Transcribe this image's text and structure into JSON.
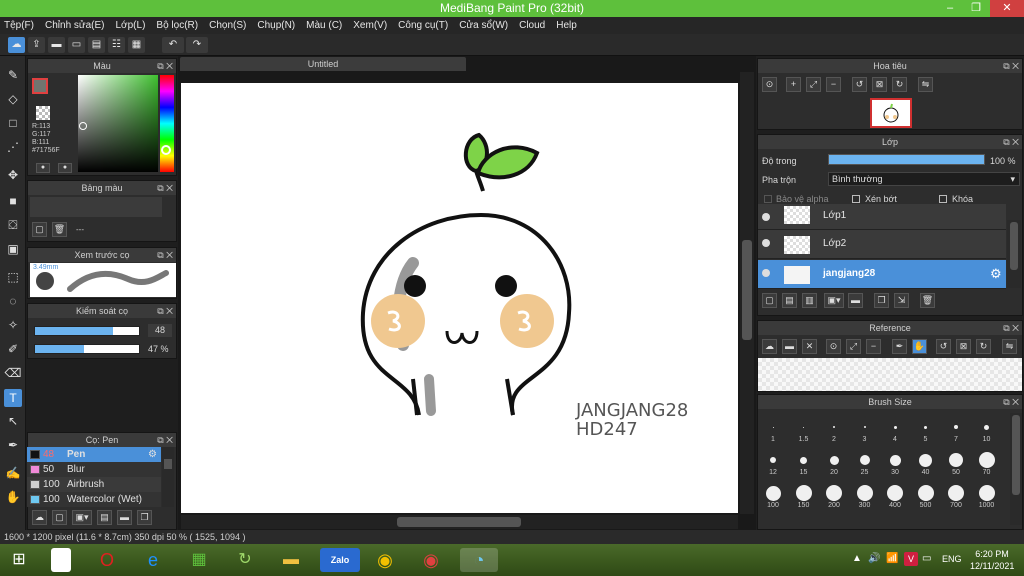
{
  "window": {
    "title": "MediBang Paint Pro (32bit)",
    "minimize": "–",
    "restore": "❐",
    "close": "✕"
  },
  "menu": [
    "Tệp(F)",
    "Chỉnh sửa(E)",
    "Lớp(L)",
    "Bộ lọc(R)",
    "Chọn(S)",
    "Chụp(N)",
    "Màu (C)",
    "Xem(V)",
    "Công cụ(T)",
    "Cửa sổ(W)",
    "Cloud",
    "Help"
  ],
  "color_panel": {
    "title": "Màu",
    "r": "R:113",
    "g": "G:117",
    "b": "B:111",
    "hex": "#71756F"
  },
  "palette_panel": {
    "title": "Bảng màu",
    "value": "---"
  },
  "brush_preview": {
    "title": "Xem trước cọ",
    "size": "3.49mm"
  },
  "brush_control": {
    "title": "Kiểm soát cọ",
    "size_value": "48",
    "opacity_value": "47 %",
    "size_fill": 0.75,
    "opacity_fill": 0.47
  },
  "brush_list": {
    "title": "Cọ: Pen",
    "items": [
      {
        "size": "48",
        "name": "Pen",
        "color": "#111111",
        "selected": true
      },
      {
        "size": "50",
        "name": "Blur",
        "color": "#f08ad8",
        "selected": false
      },
      {
        "size": "100",
        "name": "Airbrush",
        "color": "#cfcfcf",
        "selected": false
      },
      {
        "size": "100",
        "name": "Watercolor (Wet)",
        "color": "#6ec8f0",
        "selected": false
      }
    ]
  },
  "document": {
    "tab": "Untitled",
    "text_line1": "JANGJANG28",
    "text_line2": "HD247"
  },
  "navigator": {
    "title": "Hoa tiêu"
  },
  "layer_panel": {
    "title": "Lớp",
    "opacity_label": "Độ trong",
    "opacity_value": "100 %",
    "opacity_fill": 1.0,
    "blend_label": "Pha trộn",
    "blend_value": "Bình thường",
    "protect_alpha": "Bảo vệ alpha",
    "clipping": "Xén bớt",
    "lock": "Khóa",
    "layers": [
      {
        "name": "Lớp1",
        "selected": false
      },
      {
        "name": "Lớp2",
        "selected": false
      },
      {
        "name": "jangjang28",
        "selected": true
      }
    ]
  },
  "reference_panel": {
    "title": "Reference"
  },
  "brush_size_panel": {
    "title": "Brush Size",
    "sizes": [
      "1",
      "1.5",
      "2",
      "3",
      "4",
      "5",
      "7",
      "10",
      "12",
      "15",
      "20",
      "25",
      "30",
      "40",
      "50",
      "70",
      "100",
      "150",
      "200",
      "300",
      "400",
      "500",
      "700",
      "1000"
    ]
  },
  "status": "1600 * 1200 pixel  (11.6 * 8.7cm)  350 dpi  50 %  ( 1525, 1094 )",
  "taskbar": {
    "language": "ENG",
    "time": "6:20 PM",
    "date": "12/11/2021",
    "zalo": "Zalo",
    "v_badge": "V"
  }
}
